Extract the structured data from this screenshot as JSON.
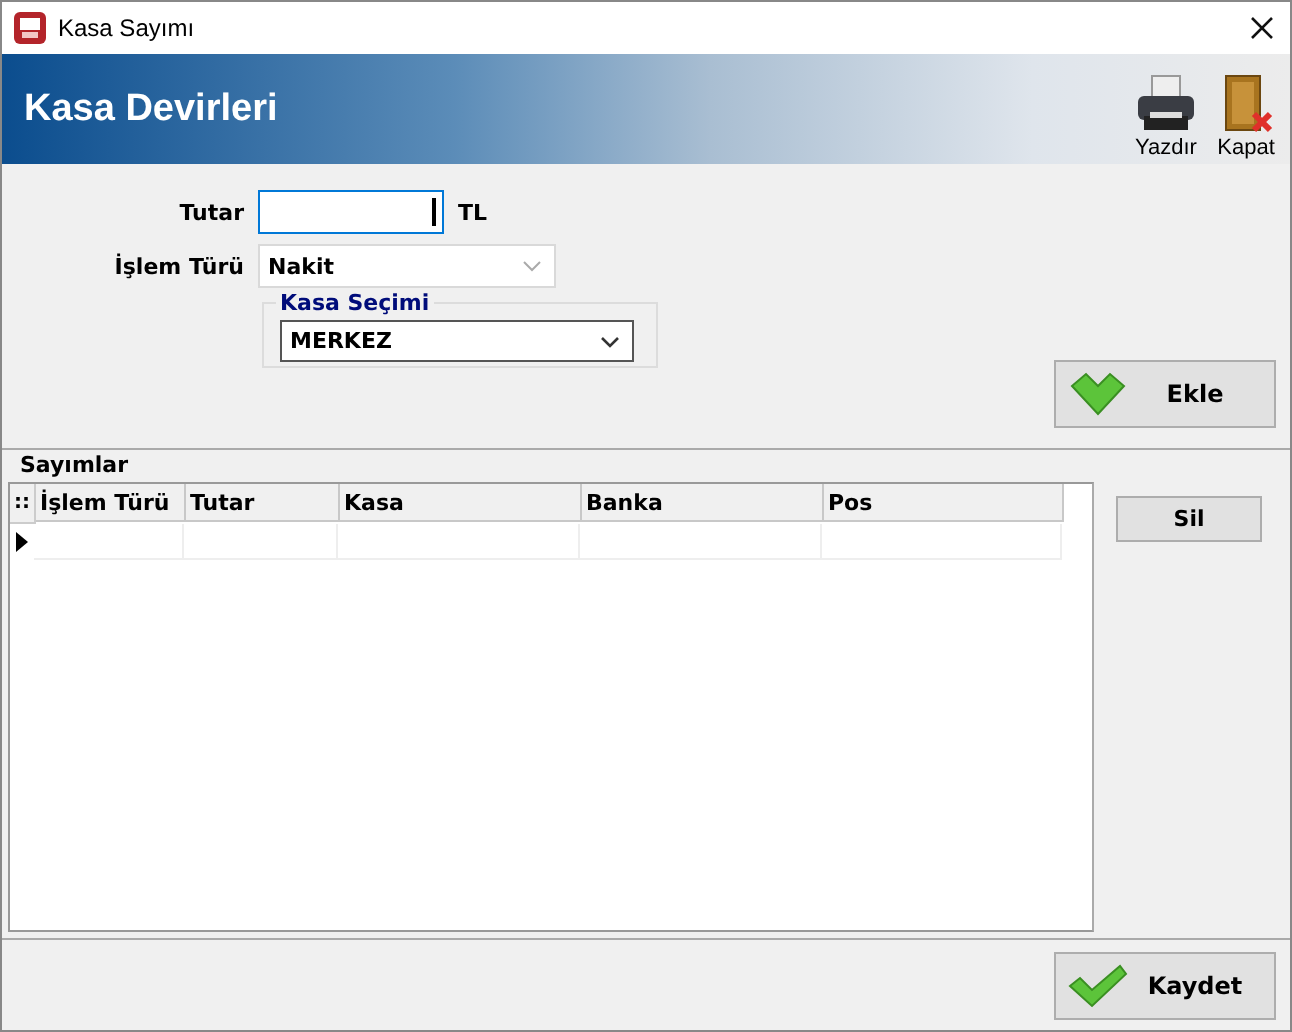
{
  "window": {
    "title": "Kasa Sayımı"
  },
  "header": {
    "title": "Kasa Devirleri",
    "tools": [
      {
        "kind": "print",
        "label": "Yazdır"
      },
      {
        "kind": "close",
        "label": "Kapat"
      }
    ]
  },
  "form": {
    "amount": {
      "label": "Tutar",
      "unit": "TL",
      "focused": true
    },
    "type": {
      "label": "İşlem Türü",
      "value": "Nakit"
    },
    "cash_box": {
      "group": "Kasa Seçimi",
      "value": "MERKEZ"
    },
    "add_button": "Ekle"
  },
  "counts": {
    "title": "Sayımlar",
    "grid_corner": "::",
    "columns": [
      "İşlem Türü",
      "Tutar",
      "Kasa",
      "Banka",
      "Pos"
    ],
    "new_row": {
      "current": true
    },
    "delete_button": "Sil"
  },
  "save_button": "Kaydet"
}
